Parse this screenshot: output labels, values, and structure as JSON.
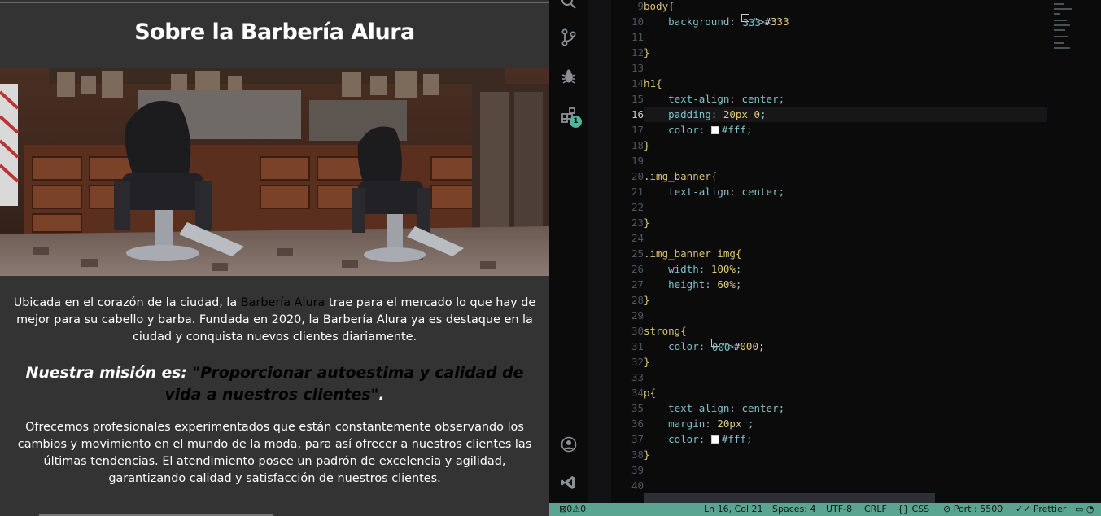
{
  "preview": {
    "title": "Sobre la Barbería Alura",
    "intro_before": "Ubicada en el corazón de la ciudad, la ",
    "intro_strong": "Barbería Alura",
    "intro_after": " trae para el mercado lo que hay de mejor para su cabello y barba. Fundada en 2020, la Barbería Alura ya es destaque en la ciudad y conquista nuevos clientes diariamente.",
    "mission_lead": "Nuestra misión es: ",
    "mission_strong": "\"Proporcionar autoestima y calidad de vida a nuestros clientes\"",
    "mission_end": ".",
    "offer": "Ofrecemos profesionales experimentados que están constantemente observando los cambios y movimiento en el mundo de la moda, para así ofrecer a nuestros clientes las últimas tendencias. El atendimiento posee un padrón de excelencia y agilidad, garantizando calidad y satisfacción de nuestros clientes."
  },
  "editor": {
    "activity_badge": "1",
    "current_line": 16,
    "lines": [
      {
        "n": "9",
        "text": "body{"
      },
      {
        "n": "10",
        "text": "    background: #333"
      },
      {
        "n": "11",
        "text": ""
      },
      {
        "n": "12",
        "text": "}"
      },
      {
        "n": "13",
        "text": ""
      },
      {
        "n": "14",
        "text": "h1{"
      },
      {
        "n": "15",
        "text": "    text-align: center;"
      },
      {
        "n": "16",
        "text": "    padding: 20px 0;"
      },
      {
        "n": "17",
        "text": "    color: #fff;"
      },
      {
        "n": "18",
        "text": "}"
      },
      {
        "n": "19",
        "text": ""
      },
      {
        "n": "20",
        "text": ".img_banner{"
      },
      {
        "n": "21",
        "text": "    text-align: center;"
      },
      {
        "n": "22",
        "text": ""
      },
      {
        "n": "23",
        "text": "}"
      },
      {
        "n": "24",
        "text": ""
      },
      {
        "n": "25",
        "text": ".img_banner img{"
      },
      {
        "n": "26",
        "text": "    width: 100%;"
      },
      {
        "n": "27",
        "text": "    height: 60%;"
      },
      {
        "n": "28",
        "text": "}"
      },
      {
        "n": "29",
        "text": ""
      },
      {
        "n": "30",
        "text": "strong{"
      },
      {
        "n": "31",
        "text": "    color: #000;"
      },
      {
        "n": "32",
        "text": "}"
      },
      {
        "n": "33",
        "text": ""
      },
      {
        "n": "34",
        "text": "p{"
      },
      {
        "n": "35",
        "text": "    text-align: center;"
      },
      {
        "n": "36",
        "text": "    margin: 20px ;"
      },
      {
        "n": "37",
        "text": "    color: #fff;"
      },
      {
        "n": "38",
        "text": "}"
      },
      {
        "n": "39",
        "text": ""
      },
      {
        "n": "40",
        "text": ""
      }
    ]
  },
  "statusbar": {
    "remote": "⊠0⚠0",
    "position": "Ln 16, Col 21",
    "spaces": "Spaces: 4",
    "encoding": "UTF-8",
    "eol": "CRLF",
    "language": "{} CSS",
    "port": "⊘ Port : 5500",
    "prettier": "✓✓ Prettier"
  },
  "colors": {
    "page_bg": "#333333",
    "editor_bg": "#0b0b0c",
    "statusbar_bg": "#5aa591",
    "selector": "#d8c071",
    "property": "#7ec1c8",
    "value": "#e0c77a"
  },
  "icons": [
    "search-icon",
    "source-control-icon",
    "debug-icon",
    "extensions-icon",
    "account-icon",
    "vscode-icon"
  ]
}
